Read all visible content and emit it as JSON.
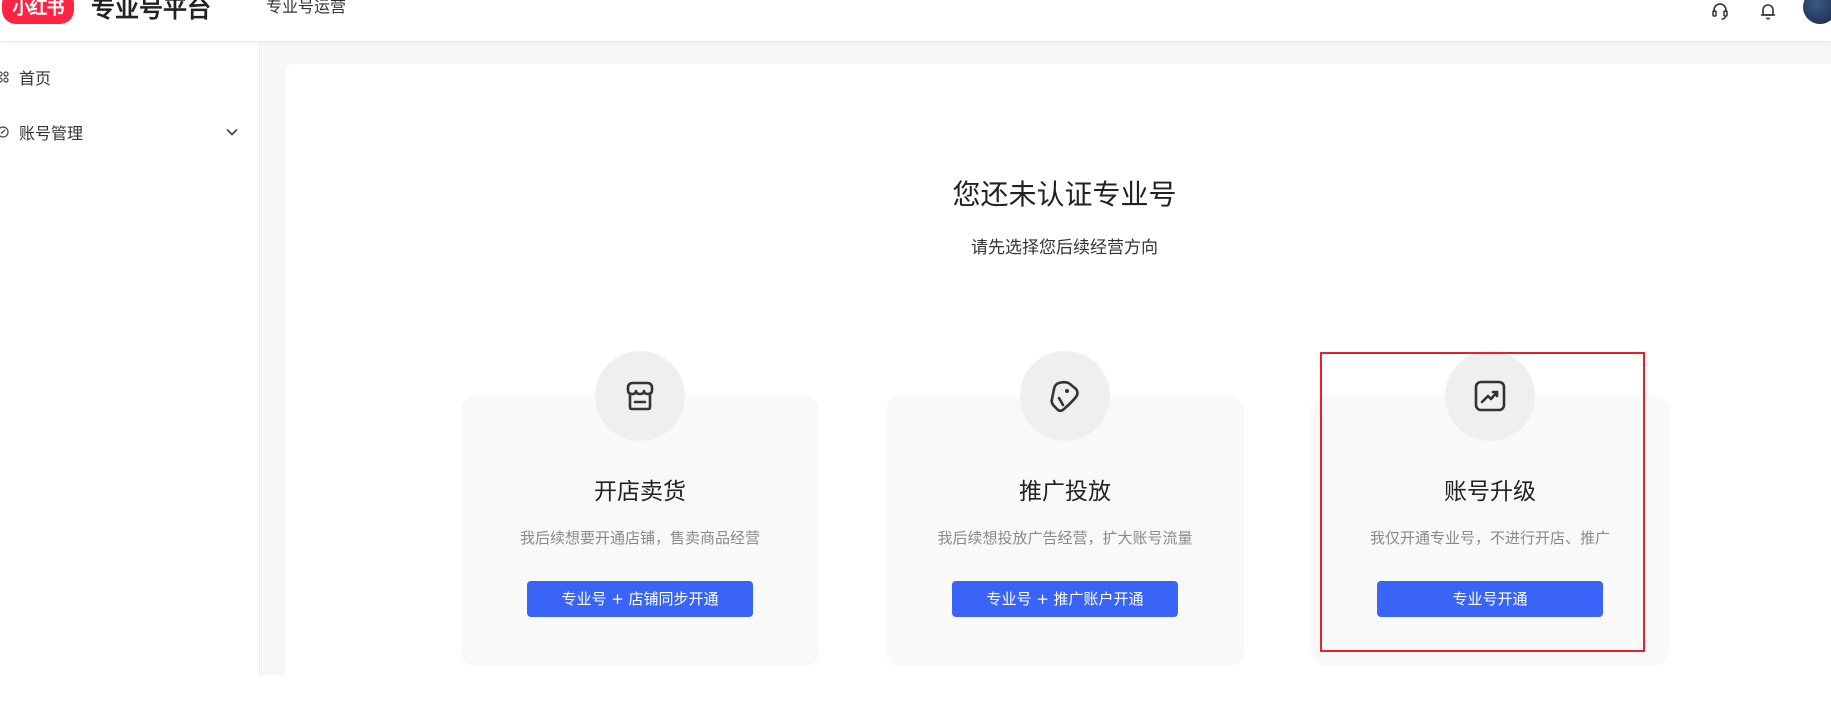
{
  "header": {
    "logo_text": "小红书",
    "platform_title": "专业号平台",
    "nav_link": "专业号运营",
    "icons": [
      "headset-icon",
      "bell-icon"
    ]
  },
  "sidebar": {
    "items": [
      {
        "label": "首页",
        "icon": "home-icon"
      },
      {
        "label": "账号管理",
        "icon": "account-icon",
        "expandable": true
      }
    ]
  },
  "main": {
    "headline": "您还未认证专业号",
    "subline": "请先选择您后续经营方向",
    "options": [
      {
        "icon": "shop-icon",
        "title": "开店卖货",
        "desc": "我后续想要开通店铺，售卖商品经营",
        "button": "专业号 + 店铺同步开通"
      },
      {
        "icon": "tag-icon",
        "title": "推广投放",
        "desc": "我后续想投放广告经营，扩大账号流量",
        "button": "专业号 + 推广账户开通"
      },
      {
        "icon": "trend-up-icon",
        "title": "账号升级",
        "desc": "我仅开通专业号，不进行开店、推广",
        "button": "专业号开通",
        "highlighted": true
      }
    ]
  },
  "colors": {
    "brand_red": "#ff2442",
    "button_blue": "#3a64f8",
    "highlight_red": "#e8202a",
    "card_bg": "#f9f9f9"
  }
}
